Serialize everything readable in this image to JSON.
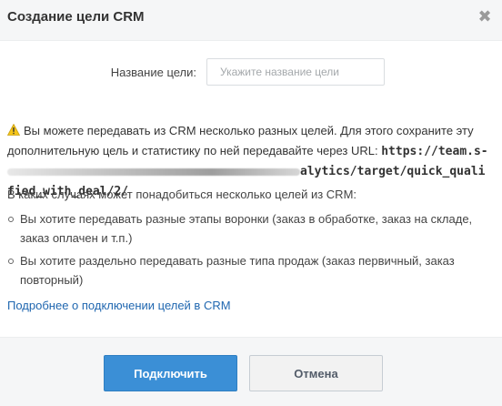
{
  "dialog": {
    "title": "Создание цели CRM",
    "close_icon": "close-icon"
  },
  "form": {
    "label": "Название цели:",
    "placeholder": "Укажите название цели",
    "value": ""
  },
  "info": {
    "warning_icon": "warning-icon",
    "text": "Вы можете передавать из CRM несколько разных целей. Для этого сохраните эту дополнительную цель и статистику по ней передавайте через URL:",
    "url_start": "https://team.s-",
    "url_end": "alytics/target/quick_qualified_with_deal/2/"
  },
  "cases": {
    "title": "В каких случаях может понадобиться несколько целей из CRM:",
    "items": [
      "Вы хотите передавать разные этапы воронки (заказ в обработке, заказ на складе, заказ оплачен и т.п.)",
      "Вы хотите раздельно передавать разные типа продаж (заказ первичный, заказ повторный)"
    ]
  },
  "link": {
    "text": "Подробнее о подключении целей в CRM"
  },
  "footer": {
    "connect_label": "Подключить",
    "cancel_label": "Отмена"
  },
  "colors": {
    "primary": "#3b8fd6",
    "link": "#2067b0",
    "warning": "#f5c518"
  }
}
